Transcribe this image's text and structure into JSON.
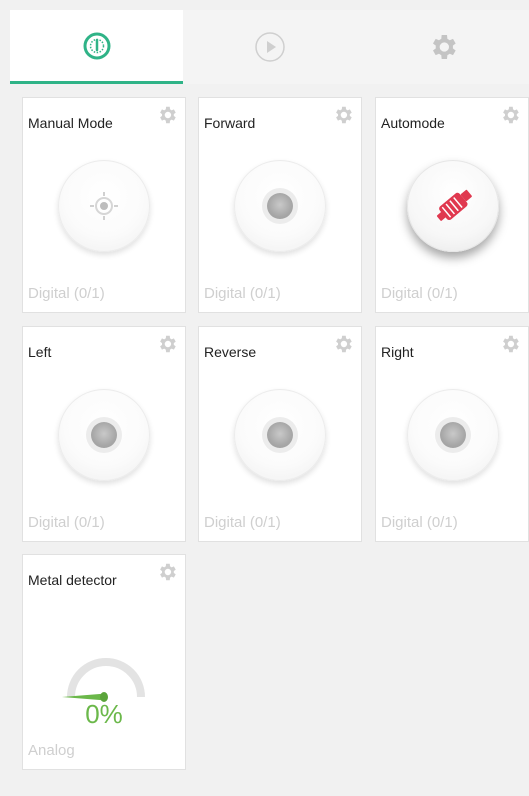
{
  "colors": {
    "accent": "#2fb387",
    "gear": "#c9c9c9",
    "subtext": "#cfcfcf",
    "gauge_green": "#6bb84a",
    "automode_icon": "#e0384f"
  },
  "tabs": [
    {
      "icon": "dashboard-gauge-icon",
      "active": true
    },
    {
      "icon": "play-icon",
      "active": false
    },
    {
      "icon": "settings-gear-icon",
      "active": false
    }
  ],
  "widgets": [
    {
      "title": "Manual Mode",
      "type_label": "Digital (0/1)",
      "state": "off",
      "icon": "crosshair-icon"
    },
    {
      "title": "Forward",
      "type_label": "Digital (0/1)",
      "state": "off"
    },
    {
      "title": "Automode",
      "type_label": "Digital (0/1)",
      "state": "on",
      "icon": "robot-arm-icon"
    },
    {
      "title": "Left",
      "type_label": "Digital (0/1)",
      "state": "off"
    },
    {
      "title": "Reverse",
      "type_label": "Digital (0/1)",
      "state": "off"
    },
    {
      "title": "Right",
      "type_label": "Digital (0/1)",
      "state": "off"
    },
    {
      "title": "Metal detector",
      "type_label": "Analog",
      "value": 0,
      "value_text": "0%"
    }
  ]
}
